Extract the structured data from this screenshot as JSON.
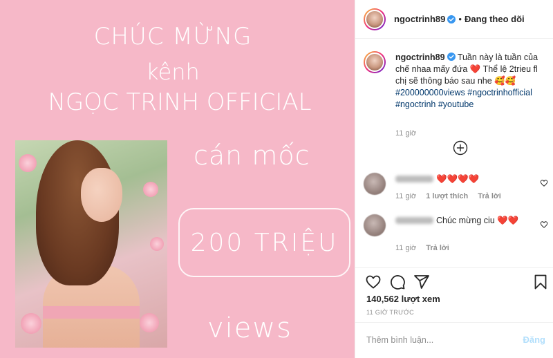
{
  "media": {
    "line1": "CHÚC MỪNG",
    "line2": "kênh",
    "line3": "NGỌC TRINH OFFICIAL",
    "line4": "cán mốc",
    "milestone": "200 TRIỆU",
    "line5": "views"
  },
  "header": {
    "username": "ngoctrinh89",
    "separator": "•",
    "follow_status": "Đang theo dõi"
  },
  "caption": {
    "username": "ngoctrinh89",
    "text_part1": "Tuần này là tuần của chế nhaa mấy đứa",
    "heart": "❤️",
    "text_part2": "Thể lệ 2trieu fl chị sẽ thông báo sau nhe",
    "emoji": "🥰🥰",
    "hashtags": [
      "#200000000views",
      "#ngoctrinhofficial",
      "#ngoctrinh",
      "#youtube"
    ],
    "time": "11 giờ"
  },
  "comments": [
    {
      "text": "❤️❤️❤️❤️",
      "time": "11 giờ",
      "likes": "1 lượt thích",
      "reply": "Trả lời"
    },
    {
      "text": "Chúc mừng ciu ❤️❤️",
      "time": "11 giờ",
      "reply": "Trả lời"
    }
  ],
  "stats": {
    "views": "140,562 lượt xem",
    "ago": "11 GIỜ TRƯỚC"
  },
  "composer": {
    "placeholder": "Thêm bình luận...",
    "post_label": "Đăng"
  },
  "colors": {
    "media_bg": "#f6b8c8",
    "hashtag": "#00376b",
    "muted": "#8e8e8e",
    "post_disabled": "#b2dffc",
    "verified": "#3897f0"
  },
  "icons": [
    "verified-badge-icon",
    "add-circle-icon",
    "heart-icon",
    "comment-icon",
    "share-icon",
    "bookmark-icon"
  ]
}
